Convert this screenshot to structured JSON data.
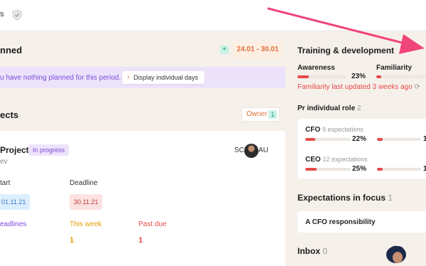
{
  "topbar": {
    "crumb": "s"
  },
  "planned": {
    "title": "nned",
    "add_label": "+",
    "date_range": "24.01 - 30.01",
    "banner_msg": "u have nothing planned for this period.",
    "display_btn": "Display individual days"
  },
  "projects": {
    "title": "ects",
    "owner_label": "Owner",
    "owner_count": "1",
    "card": {
      "name": "Project",
      "status": "In progress",
      "sub": "ev",
      "avatars": [
        "SC",
        "AU"
      ],
      "start_label": "tart",
      "start_value": "01.11.21",
      "deadline_label": "Deadline",
      "deadline_value": "30.11.21",
      "stats": [
        {
          "label": "eadlines",
          "value": "",
          "color": "#7b4bd8"
        },
        {
          "label": "This week",
          "value": "1",
          "color": "#e0a000"
        },
        {
          "label": "Past due",
          "value": "1",
          "color": "#e64a4a"
        }
      ]
    }
  },
  "training": {
    "title": "Training & development",
    "awareness_label": "Awareness",
    "awareness_pct": "23%",
    "awareness_fill": 0.23,
    "familiarity_label": "Familiarity",
    "familiarity_fill": 0.1,
    "warning": "Familiarity last updated 3 weeks ago",
    "role_title": "Pr individual role",
    "role_count": "2",
    "roles": [
      {
        "name": "CFO",
        "expectations": "9 expectations",
        "pct": "22%",
        "fill": 0.22,
        "extra": "1"
      },
      {
        "name": "CEO",
        "expectations": "12 expectations",
        "pct": "25%",
        "fill": 0.25,
        "extra": "1"
      }
    ],
    "focus_title": "Expectations in focus",
    "focus_count": "1",
    "focus_item": "A CFO responsibility",
    "inbox_title": "Inbox",
    "inbox_count": "0"
  },
  "colors": {
    "accent_orange": "#e0703a",
    "accent_purple": "#7b4bd8",
    "accent_red": "#e64a4a",
    "arrow_pink": "#f0457a"
  }
}
